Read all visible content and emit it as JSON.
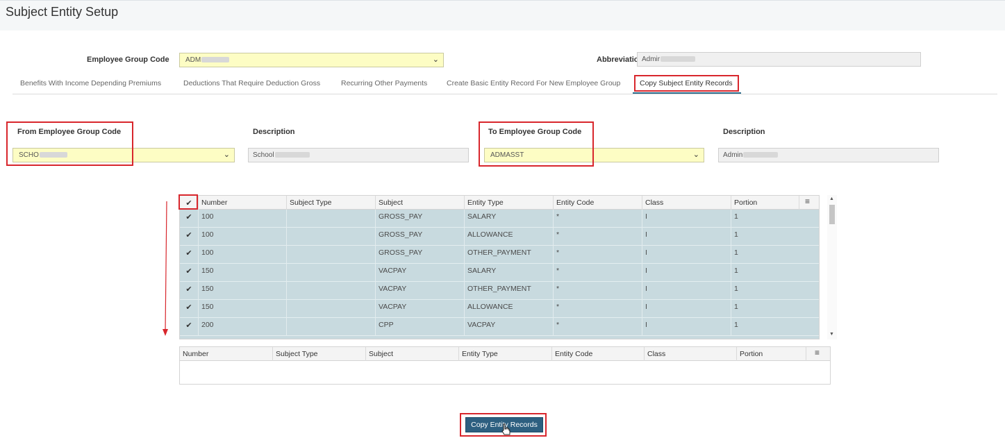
{
  "page": {
    "title": "Subject Entity Setup"
  },
  "employee_group": {
    "label": "Employee Group Code",
    "value": "ADM",
    "abbreviation_label": "Abbreviation",
    "abbreviation_value": "Admir"
  },
  "tabs": [
    {
      "label": "Benefits With Income Depending Premiums"
    },
    {
      "label": "Deductions That Require Deduction Gross"
    },
    {
      "label": "Recurring Other Payments"
    },
    {
      "label": "Create Basic Entity Record For New Employee Group"
    },
    {
      "label": "Copy Subject Entity Records",
      "active": true
    }
  ],
  "copy_form": {
    "from_label": "From Employee Group Code",
    "from_value": "SCHO",
    "from_desc_label": "Description",
    "from_desc_value": "School",
    "to_label": "To Employee Group Code",
    "to_value": "ADMASST",
    "to_desc_label": "Description",
    "to_desc_value": "Admin"
  },
  "source_grid": {
    "check_icon": "✔",
    "columns": [
      "Number",
      "Subject Type",
      "Subject",
      "Entity Type",
      "Entity Code",
      "Class",
      "Portion"
    ],
    "rows": [
      {
        "number": "100",
        "subject_type": "",
        "subject": "GROSS_PAY",
        "entity_type": "SALARY",
        "entity_code": "*",
        "class": "I",
        "portion": "1"
      },
      {
        "number": "100",
        "subject_type": "",
        "subject": "GROSS_PAY",
        "entity_type": "ALLOWANCE",
        "entity_code": "*",
        "class": "I",
        "portion": "1"
      },
      {
        "number": "100",
        "subject_type": "",
        "subject": "GROSS_PAY",
        "entity_type": "OTHER_PAYMENT",
        "entity_code": "*",
        "class": "I",
        "portion": "1"
      },
      {
        "number": "150",
        "subject_type": "",
        "subject": "VACPAY",
        "entity_type": "SALARY",
        "entity_code": "*",
        "class": "I",
        "portion": "1"
      },
      {
        "number": "150",
        "subject_type": "",
        "subject": "VACPAY",
        "entity_type": "OTHER_PAYMENT",
        "entity_code": "*",
        "class": "I",
        "portion": "1"
      },
      {
        "number": "150",
        "subject_type": "",
        "subject": "VACPAY",
        "entity_type": "ALLOWANCE",
        "entity_code": "*",
        "class": "I",
        "portion": "1"
      },
      {
        "number": "200",
        "subject_type": "",
        "subject": "CPP",
        "entity_type": "VACPAY",
        "entity_code": "*",
        "class": "I",
        "portion": "1"
      }
    ]
  },
  "target_grid": {
    "columns": [
      "Number",
      "Subject Type",
      "Subject",
      "Entity Type",
      "Entity Code",
      "Class",
      "Portion"
    ]
  },
  "actions": {
    "copy_button": "Copy Entity Records"
  },
  "icons": {
    "menu": "≡",
    "chevron": "⌄",
    "scroll_up": "▲",
    "scroll_down": "▼"
  },
  "colors": {
    "accent": "#2d5f80",
    "highlight_red": "#d8262c",
    "selected_row": "#c8dadf",
    "dropdown_bg": "#fdfdc4"
  }
}
